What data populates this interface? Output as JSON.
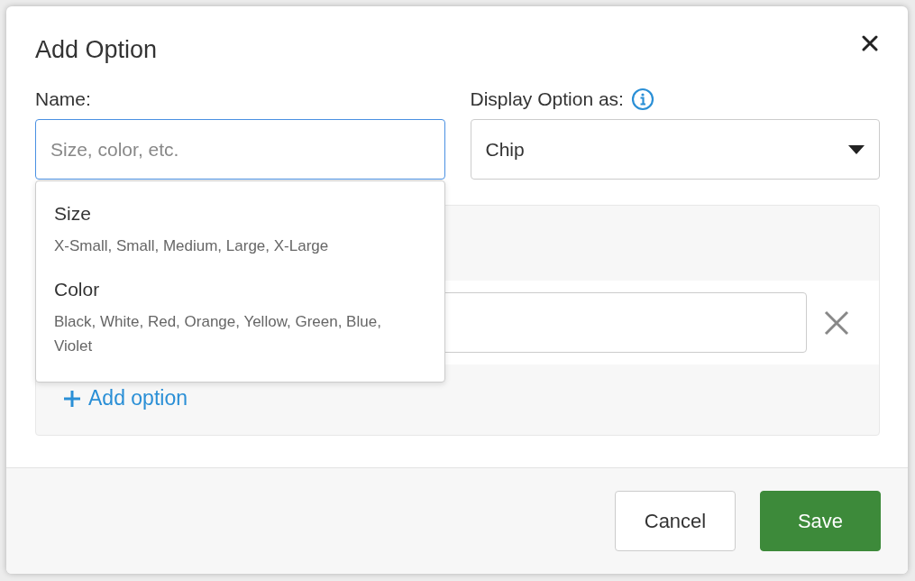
{
  "dialog": {
    "title": "Add Option"
  },
  "name_field": {
    "label": "Name:",
    "placeholder": "Size, color, etc.",
    "focused": true
  },
  "suggestions": [
    {
      "name": "Size",
      "values": "X-Small, Small, Medium, Large, X-Large"
    },
    {
      "name": "Color",
      "values": "Black, White, Red, Orange, Yellow, Green, Blue, Violet"
    }
  ],
  "display_field": {
    "label": "Display Option as:",
    "value": "Chip"
  },
  "add_option": {
    "label": "Add option"
  },
  "buttons": [
    {
      "label": "Cancel",
      "kind": "secondary"
    },
    {
      "label": "Save",
      "kind": "primary"
    }
  ]
}
